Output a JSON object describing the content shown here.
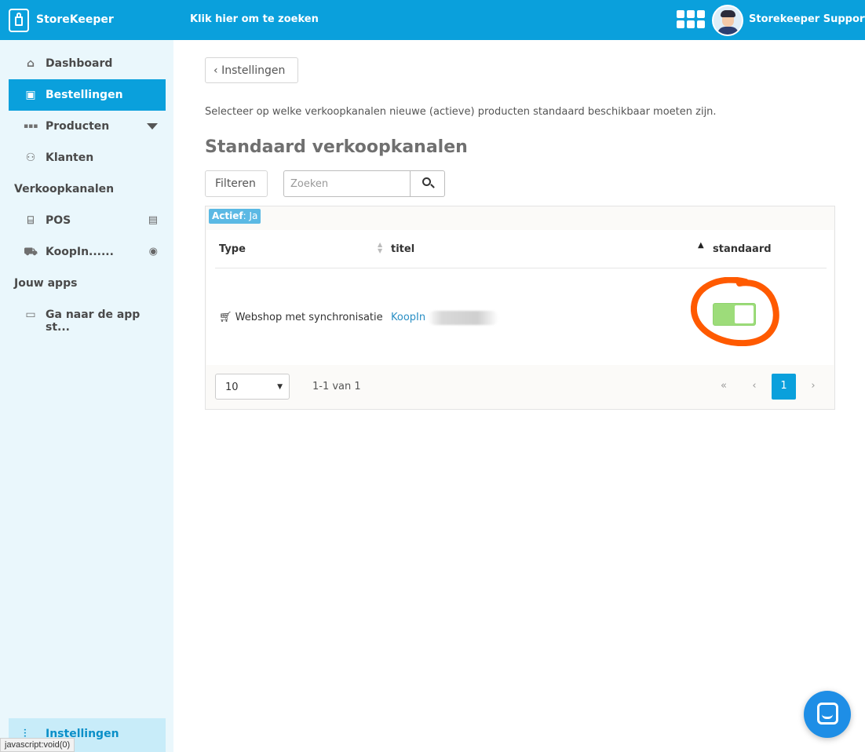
{
  "topbar": {
    "brand": "StoreKeeper",
    "search_label": "Klik hier om te zoeken",
    "user_name": "Storekeeper Support"
  },
  "sidebar": {
    "items": [
      {
        "label": "Dashboard",
        "icon": "home-icon"
      },
      {
        "label": "Bestellingen",
        "icon": "orders-bag-icon"
      },
      {
        "label": "Producten",
        "icon": "products-grid-icon"
      },
      {
        "label": "Klanten",
        "icon": "customers-icon"
      }
    ],
    "section_sales": "Verkoopkanalen",
    "channels": [
      {
        "label": "POS",
        "icon": "store-icon",
        "trail_icon": "cash-register-icon"
      },
      {
        "label": "KoopIn......",
        "icon": "cart-icon",
        "trail_icon": "eye-icon"
      }
    ],
    "section_apps": "Jouw apps",
    "apps": [
      {
        "label": "Ga naar de app st...",
        "icon": "folder-icon"
      }
    ],
    "bottom": {
      "label": "Instellingen",
      "icon": "sliders-icon"
    }
  },
  "status_bar": "javascript:void(0)",
  "main": {
    "back_label": "Instellingen",
    "description": "Selecteer op welke verkoopkanalen nieuwe (actieve) producten standaard beschikbaar moeten zijn.",
    "title": "Standaard verkoopkanalen",
    "filter_button": "Filteren",
    "search_placeholder": "Zoeken",
    "active_filter": {
      "key": "Actief",
      "value": "Ja"
    },
    "columns": [
      "Type",
      "titel",
      "standaard"
    ],
    "rows": [
      {
        "type": "Webshop met synchronisatie",
        "title": "KoopIn",
        "standaard": true
      }
    ],
    "pager": {
      "page_size": "10",
      "info": "1-1 van 1",
      "first": "«",
      "prev": "‹",
      "current": "1",
      "next": "›"
    }
  },
  "colors": {
    "primary": "#0aa0dc",
    "sidebar_bg": "#eaf7fc",
    "toggle_on": "#9ddc7a",
    "annotation_ring": "#ff5a00"
  }
}
